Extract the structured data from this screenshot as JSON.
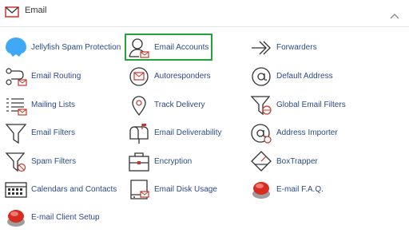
{
  "header": {
    "title": "Email",
    "icon": "envelope-icon",
    "toggle_icon": "chevron-up-icon"
  },
  "accent": "#c0392b",
  "link_color": "#2d4a88",
  "highlight_color": "#22a33a",
  "items": [
    {
      "label": "Jellyfish Spam Protection",
      "icon": "jellyfish-icon"
    },
    {
      "label": "Email Accounts",
      "icon": "user-mail-icon",
      "selected": true
    },
    {
      "label": "Forwarders",
      "icon": "forward-arrows-icon"
    },
    {
      "label": "Email Routing",
      "icon": "routing-icon"
    },
    {
      "label": "Autoresponders",
      "icon": "autoresponder-icon"
    },
    {
      "label": "Default Address",
      "icon": "at-sign-icon"
    },
    {
      "label": "Mailing Lists",
      "icon": "list-icon"
    },
    {
      "label": "Track Delivery",
      "icon": "location-pin-icon"
    },
    {
      "label": "Global Email Filters",
      "icon": "global-filter-icon"
    },
    {
      "label": "Email Filters",
      "icon": "filter-icon"
    },
    {
      "label": "Email Deliverability",
      "icon": "mailbox-icon"
    },
    {
      "label": "Address Importer",
      "icon": "at-import-icon"
    },
    {
      "label": "Spam Filters",
      "icon": "spam-filter-icon"
    },
    {
      "label": "Encryption",
      "icon": "briefcase-lock-icon"
    },
    {
      "label": "BoxTrapper",
      "icon": "box-trap-icon"
    },
    {
      "label": "Calendars and Contacts",
      "icon": "calendar-icon"
    },
    {
      "label": "Email Disk Usage",
      "icon": "disk-icon"
    },
    {
      "label": "E-mail F.A.Q.",
      "icon": "help-button-icon"
    },
    {
      "label": "E-mail Client Setup",
      "icon": "help-button-icon"
    }
  ]
}
